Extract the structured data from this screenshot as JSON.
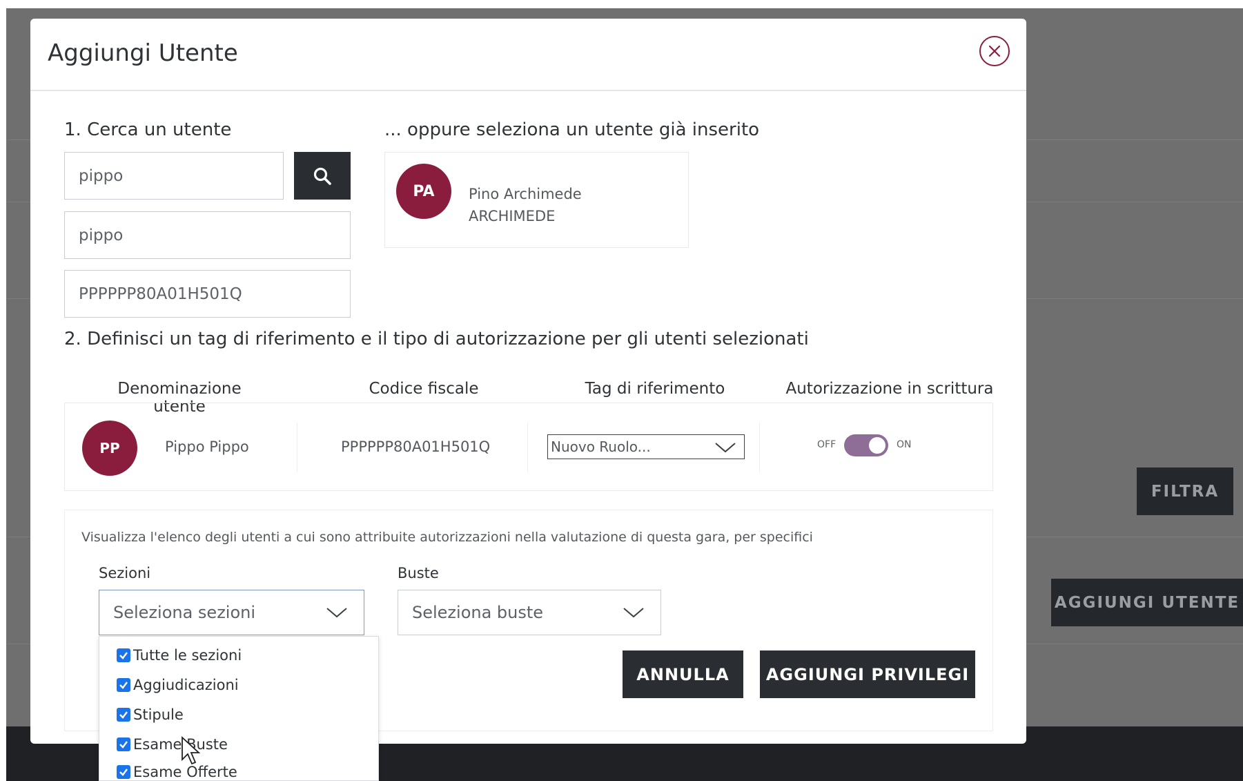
{
  "background": {
    "filter_button": "FILTRA",
    "add_user_button": "AGGIUNGI UTENTE"
  },
  "modal": {
    "title": "Aggiungi Utente",
    "close_icon": "close-circle-icon"
  },
  "search_section": {
    "heading": "1. Cerca un utente",
    "search_value": "pippo",
    "name_value": "pippo",
    "fiscal_code_value": "PPPPPP80A01H501Q",
    "search_icon": "search-icon"
  },
  "existing_section": {
    "heading": "... oppure seleziona un utente già inserito",
    "card": {
      "initials": "PA",
      "first_line": "Pino Archimede",
      "second_line": "ARCHIMEDE"
    }
  },
  "define_section": {
    "heading": "2. Definisci un tag di riferimento e il tipo di autorizzazione per gli utenti selezionati",
    "columns": [
      "Denominazione utente",
      "Codice fiscale",
      "Tag di riferimento",
      "Autorizzazione in scrittura"
    ],
    "row": {
      "initials": "PP",
      "name": "Pippo Pippo",
      "fiscal_code": "PPPPPP80A01H501Q",
      "tag_value": "Nuovo Ruolo...",
      "toggle_off_label": "OFF",
      "toggle_on_label": "ON",
      "write_authorization": true
    }
  },
  "filter_section": {
    "description": "Visualizza l'elenco degli utenti a cui sono attribuite autorizzazioni nella valutazione di questa gara, per specifici",
    "sections_label": "Sezioni",
    "sections_placeholder": "Seleziona sezioni",
    "envelopes_label": "Buste",
    "envelopes_placeholder": "Seleziona buste",
    "sections_options": [
      {
        "label": "Tutte le sezioni",
        "checked": true
      },
      {
        "label": "Aggiudicazioni",
        "checked": true
      },
      {
        "label": "Stipule",
        "checked": true
      },
      {
        "label": "Esame Buste",
        "checked": true
      },
      {
        "label": "Esame Offerte",
        "checked": true
      }
    ]
  },
  "actions": {
    "cancel": "ANNULLA",
    "add_privileges": "AGGIUNGI PRIVILEGI"
  },
  "colors": {
    "accent": "#8a1d3d",
    "dark_button": "#2a2e33",
    "toggle": "#8e6e96",
    "checkbox": "#1a73e8"
  }
}
